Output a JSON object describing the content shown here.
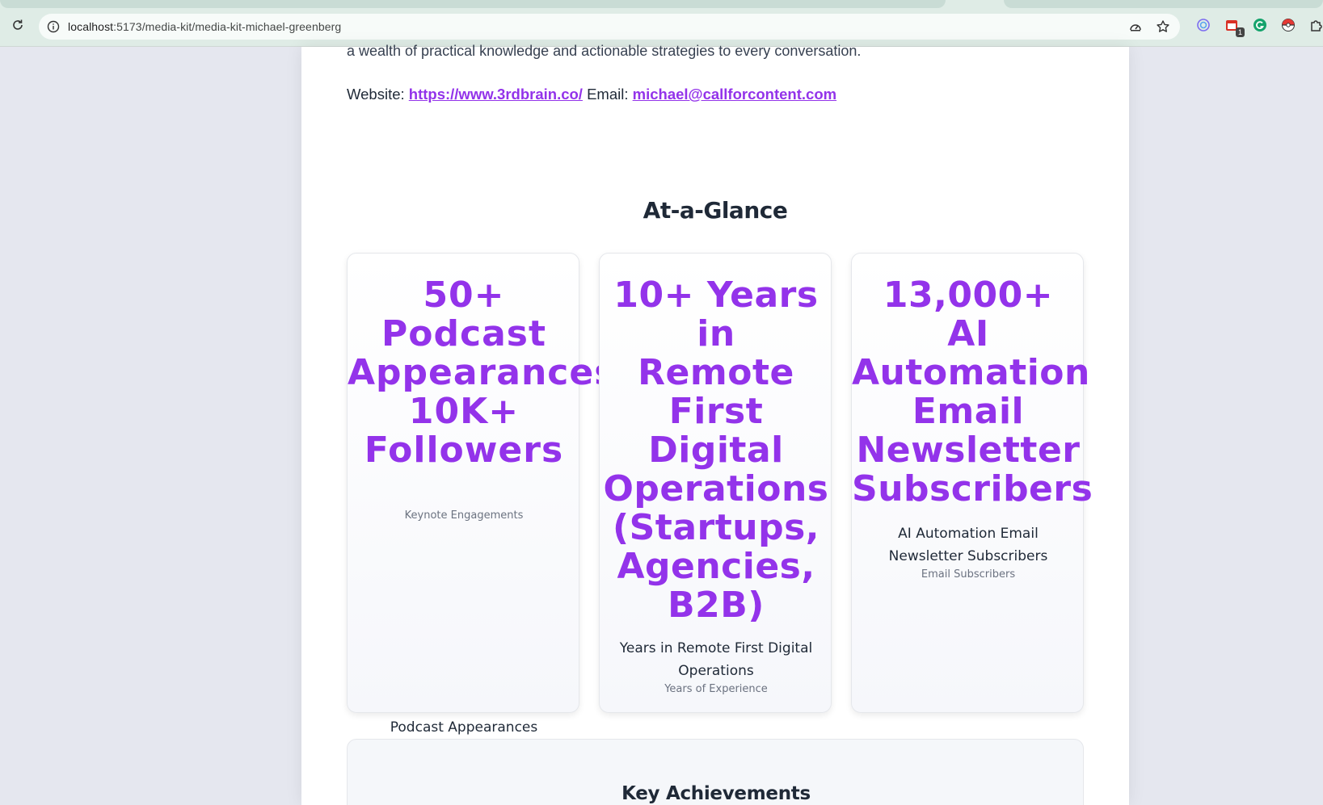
{
  "browser": {
    "url_host": "localhost",
    "url_path": ":5173/media-kit/media-kit-michael-greenberg",
    "extension_badge": "1"
  },
  "page": {
    "intro_tail": "a wealth of practical knowledge and actionable strategies to every conversation.",
    "contact": {
      "website_label": "Website:",
      "website_url": "https://www.3rdbrain.co/",
      "email_label": "Email:",
      "email": "michael@callforcontent.com"
    },
    "at_a_glance": {
      "title": "At-a-Glance",
      "cards": [
        {
          "value": "50+\nPodcast\nAppearances\n10K+\nFollowers",
          "label": "Podcast Appearances",
          "sub": "Keynote Engagements"
        },
        {
          "value": "10+ Years\nin\nRemote\nFirst\nDigital\nOperations\n(Startups,\nAgencies,\nB2B)",
          "label": "Years in Remote First Digital Operations",
          "sub": "Years of Experience"
        },
        {
          "value": "13,000+\nAI\nAutomation\nEmail\nNewsletter\nSubscribers",
          "label": "AI Automation Email Newsletter Subscribers",
          "sub": "Email Subscribers"
        }
      ]
    },
    "key_achievements": {
      "title": "Key Achievements"
    }
  },
  "colors": {
    "accent": "#9333ea",
    "text": "#1f2937",
    "muted": "#6b7280",
    "background": "#e5e7ef"
  }
}
